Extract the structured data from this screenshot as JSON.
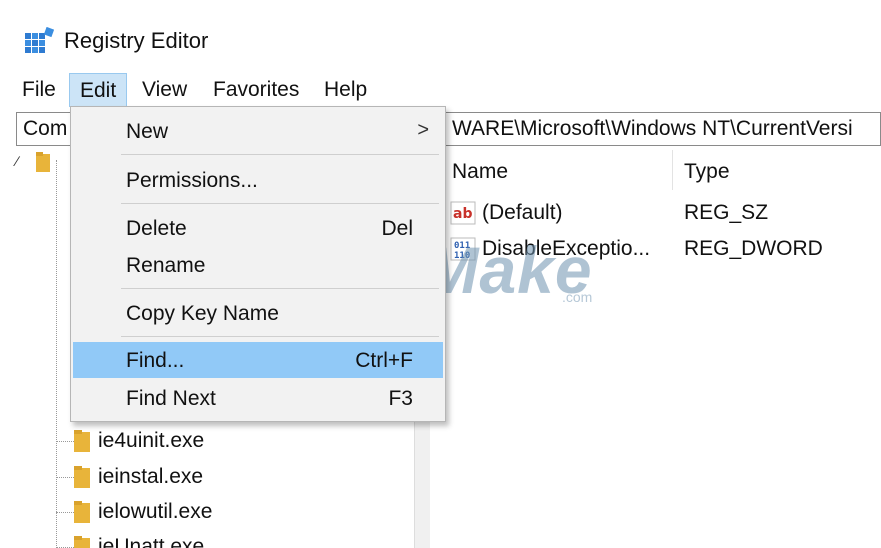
{
  "window": {
    "title": "Registry Editor",
    "icon": "registry-editor-icon"
  },
  "menubar": {
    "items": [
      {
        "label": "File"
      },
      {
        "label": "Edit"
      },
      {
        "label": "View"
      },
      {
        "label": "Favorites"
      },
      {
        "label": "Help"
      }
    ],
    "active": "Edit"
  },
  "address": {
    "left_text": "Com",
    "right_text": "WARE\\Microsoft\\Windows NT\\CurrentVersi"
  },
  "edit_menu": {
    "items": [
      {
        "label": "New",
        "shortcut": "",
        "submenu_arrow": ">"
      },
      {
        "label": "Permissions...",
        "shortcut": ""
      },
      {
        "label": "Delete",
        "shortcut": "Del"
      },
      {
        "label": "Rename",
        "shortcut": ""
      },
      {
        "label": "Copy Key Name",
        "shortcut": ""
      },
      {
        "label": "Find...",
        "shortcut": "Ctrl+F"
      },
      {
        "label": "Find Next",
        "shortcut": "F3"
      }
    ],
    "highlighted": "Find..."
  },
  "tree": {
    "items": [
      {
        "label": "ie4uinit.exe"
      },
      {
        "label": "ieinstal.exe"
      },
      {
        "label": "ielowutil.exe"
      },
      {
        "label": "ieUnatt.exe"
      }
    ]
  },
  "values": {
    "columns": {
      "name": "Name",
      "type": "Type"
    },
    "rows": [
      {
        "name": "(Default)",
        "type": "REG_SZ",
        "icon": "string-value-icon"
      },
      {
        "name": "DisableExceptio...",
        "type": "REG_DWORD",
        "icon": "binary-value-icon"
      }
    ]
  },
  "watermark": {
    "text": "TipsMake",
    "suffix": ".com"
  },
  "colors": {
    "menu_highlight": "#91c9f7",
    "menubar_active": "#cce4f7",
    "folder": "#e8b43a"
  }
}
